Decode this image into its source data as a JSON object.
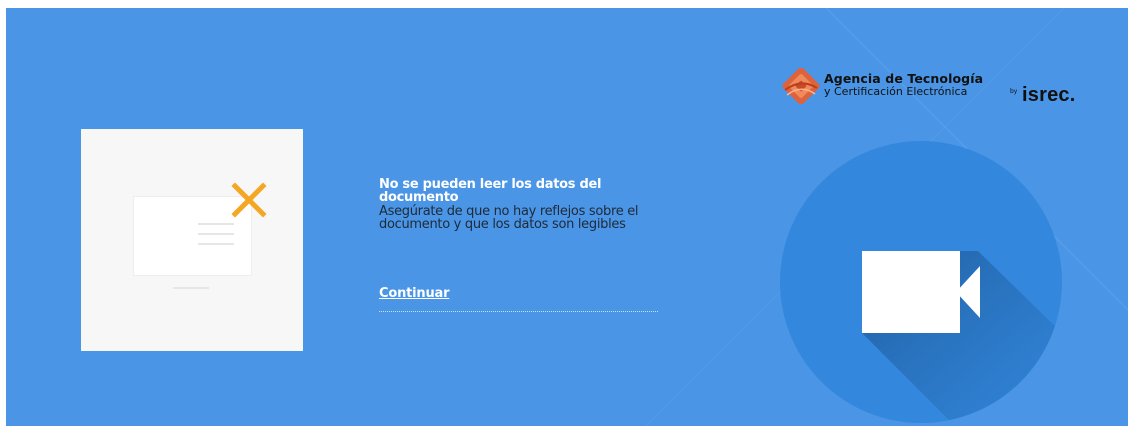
{
  "brand": {
    "name_line1": "Agencia de Tecnología",
    "name_line2": "y Certificación Electrónica",
    "by": "by",
    "partner": "isrec.",
    "logo_icon": "atce-logo-icon"
  },
  "message": {
    "title": "No se pueden leer los datos del documento",
    "body": "Asegúrate de que no hay reflejos sobre el documento y que los datos son legibles"
  },
  "actions": {
    "continue_label": "Continuar"
  },
  "illustration": {
    "error_icon": "close-x-icon",
    "camera_icon": "video-camera-icon"
  },
  "colors": {
    "background": "#4a95e5",
    "card": "#f7f7f7",
    "error_accent": "#f5a623",
    "circle": "#3388dd",
    "circle_shadow": "#1f5d9c",
    "body_text": "#1f2a38",
    "title_text": "#ffffff"
  }
}
